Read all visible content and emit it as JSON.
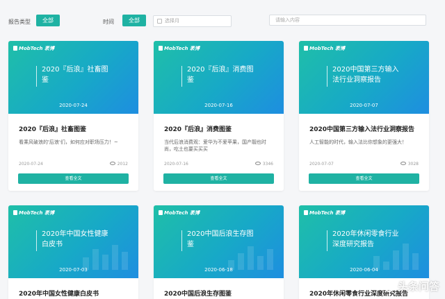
{
  "filters": {
    "report_type_label": "报告类型",
    "report_type_value": "全部",
    "time_label": "时间",
    "time_value": "全部",
    "date_placeholder": "选择月",
    "search_placeholder": "请输入内容"
  },
  "brand": "MobTech 袤博",
  "view_button": "查看全文",
  "cards": [
    {
      "banner": "2020『后浪』社畜图鉴",
      "date": "2020-07-24",
      "title": "2020『后浪』社畜图鉴",
      "desc": "看乘风破浪的'后浪'们，如何应对职场压力！~",
      "views": "2012"
    },
    {
      "banner": "2020『后浪』消费图鉴",
      "date": "2020-07-16",
      "title": "2020『后浪』消费图鉴",
      "desc": "当代后浪消费观：爱华为不爱苹果，国产靓也时尚，吃土也要买买买",
      "views": "3346"
    },
    {
      "banner": "2020中国第三方输入法行业洞察报告",
      "date": "2020-07-07",
      "title": "2020中国第三方输入法行业洞察报告",
      "desc": "人工智能的时代，输入法比你想象的更强大！",
      "views": "3028"
    },
    {
      "banner": "2020年中国女性健康白皮书",
      "date": "2020-07-03",
      "title": "2020年中国女性健康白皮书",
      "desc": "",
      "views": ""
    },
    {
      "banner": "2020中国后浪生存图鉴",
      "date": "2020-06-18",
      "title": "2020中国后浪生存图鉴",
      "desc": "",
      "views": ""
    },
    {
      "banner": "2020年休闲零食行业深度研究报告",
      "date": "2020-06-04",
      "title": "2020年休闲零食行业深度研究报告",
      "desc": "",
      "views": ""
    }
  ],
  "watermark": "头条问答"
}
